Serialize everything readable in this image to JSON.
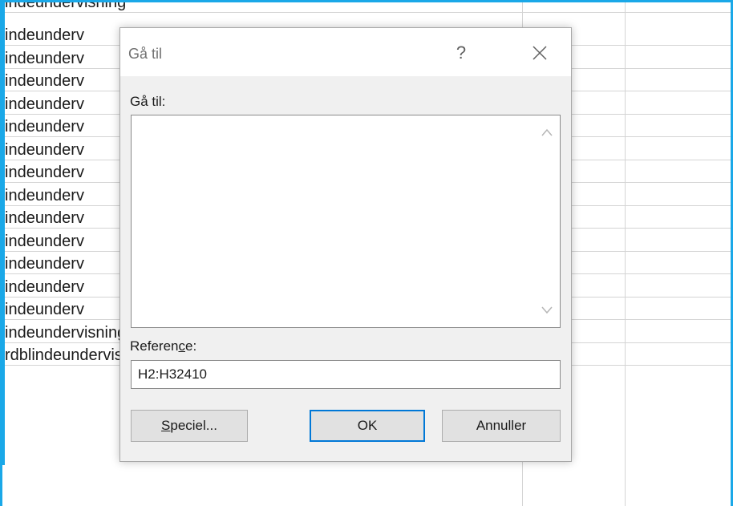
{
  "sheet": {
    "top_partial": "indeundervisning",
    "rows": [
      "indeunderv",
      "indeunderv",
      "indeunderv",
      "indeunderv",
      "indeunderv",
      "indeunderv",
      "indeunderv",
      "indeunderv",
      "indeunderv",
      "indeunderv",
      "indeunderv",
      "indeunderv",
      "indeunderv",
      "indeundervisning",
      "rdblindeundervisning"
    ],
    "selection_color": "#1aa8e8"
  },
  "dialog": {
    "title": "Gå til",
    "help_glyph": "?",
    "close_icon": "close-icon",
    "goto_label": "Gå til:",
    "reference_label_pre": "Referen",
    "reference_label_ul": "c",
    "reference_label_post": "e:",
    "reference_value": "H2:H32410",
    "special_btn_ul": "S",
    "special_btn_rest": "peciel...",
    "ok_btn": "OK",
    "cancel_btn": "Annuller",
    "accent_color": "#0078d7"
  }
}
